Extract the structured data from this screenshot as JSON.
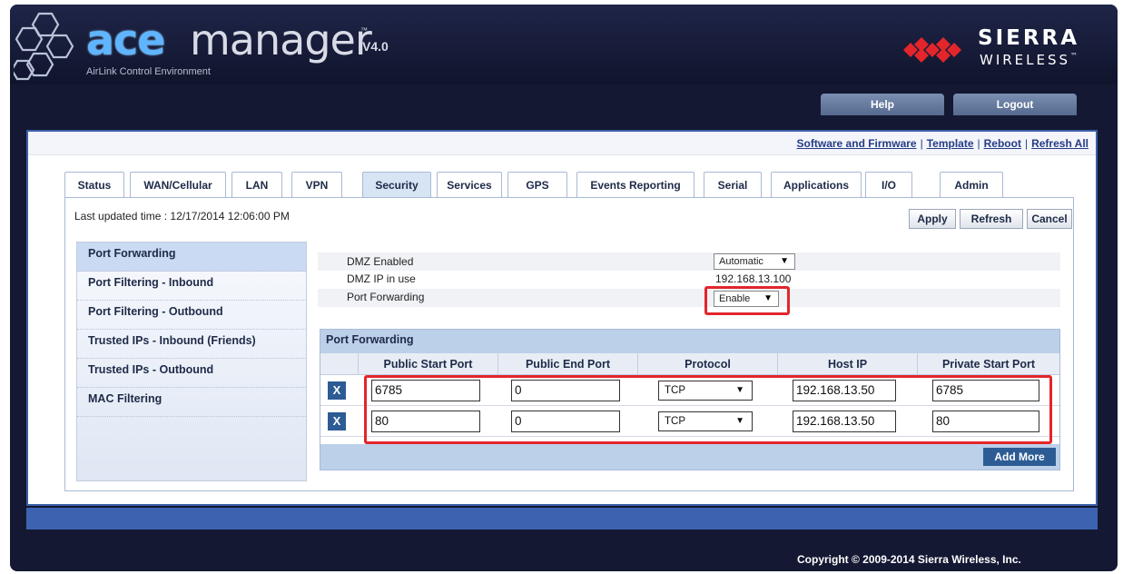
{
  "brand": {
    "ace": "ace",
    "manager": "manager",
    "tm": "™",
    "version": "V4.0",
    "subtitle": "AirLink Control Environment",
    "company_name": "SIERRA",
    "company_sub": "WIRELESS",
    "company_tm": "™"
  },
  "topnav": {
    "help": "Help",
    "logout": "Logout"
  },
  "links": [
    "Software and Firmware",
    "Template",
    "Reboot",
    "Refresh All"
  ],
  "link_separator": "|",
  "tabs": [
    "Status",
    "WAN/Cellular",
    "LAN",
    "VPN",
    "Security",
    "Services",
    "GPS",
    "Events Reporting",
    "Serial",
    "Applications",
    "I/O",
    "Admin"
  ],
  "active_tab": "Security",
  "status": {
    "last_updated": "Last updated time : 12/17/2014 12:06:00 PM"
  },
  "actions": {
    "apply": "Apply",
    "refresh": "Refresh",
    "cancel": "Cancel"
  },
  "sidebar": {
    "items": [
      "Port Forwarding",
      "Port Filtering - Inbound",
      "Port Filtering - Outbound",
      "Trusted IPs - Inbound (Friends)",
      "Trusted IPs - Outbound",
      "MAC Filtering"
    ],
    "active": "Port Forwarding"
  },
  "settings": {
    "dmz_enabled": {
      "label": "DMZ Enabled",
      "value": "Automatic",
      "arrow": "▼"
    },
    "dmz_ip": {
      "label": "DMZ IP in use",
      "value": "192.168.13.100"
    },
    "port_forwarding": {
      "label": "Port Forwarding",
      "value": "Enable",
      "arrow": "▼"
    }
  },
  "port_forwarding_table": {
    "title": "Port Forwarding",
    "columns": [
      "Public Start Port",
      "Public End Port",
      "Protocol",
      "Host IP",
      "Private Start Port"
    ],
    "delete_label": "X",
    "arrow": "▼",
    "rows": [
      {
        "public_start": "6785",
        "public_end": "0",
        "protocol": "TCP",
        "host_ip": "192.168.13.50",
        "private_start": "6785"
      },
      {
        "public_start": "80",
        "public_end": "0",
        "protocol": "TCP",
        "host_ip": "192.168.13.50",
        "private_start": "80"
      }
    ],
    "add_more": "Add More"
  },
  "footer": {
    "copyright": "Copyright © 2009-2014 Sierra Wireless, Inc."
  },
  "colors": {
    "frame_bg": "#141833",
    "accent_blue": "#3d63b0",
    "tab_active": "#d7e4f4",
    "highlight_red": "#e2262b",
    "button_blue": "#2d5c95",
    "sierra_red": "#e2262b"
  }
}
